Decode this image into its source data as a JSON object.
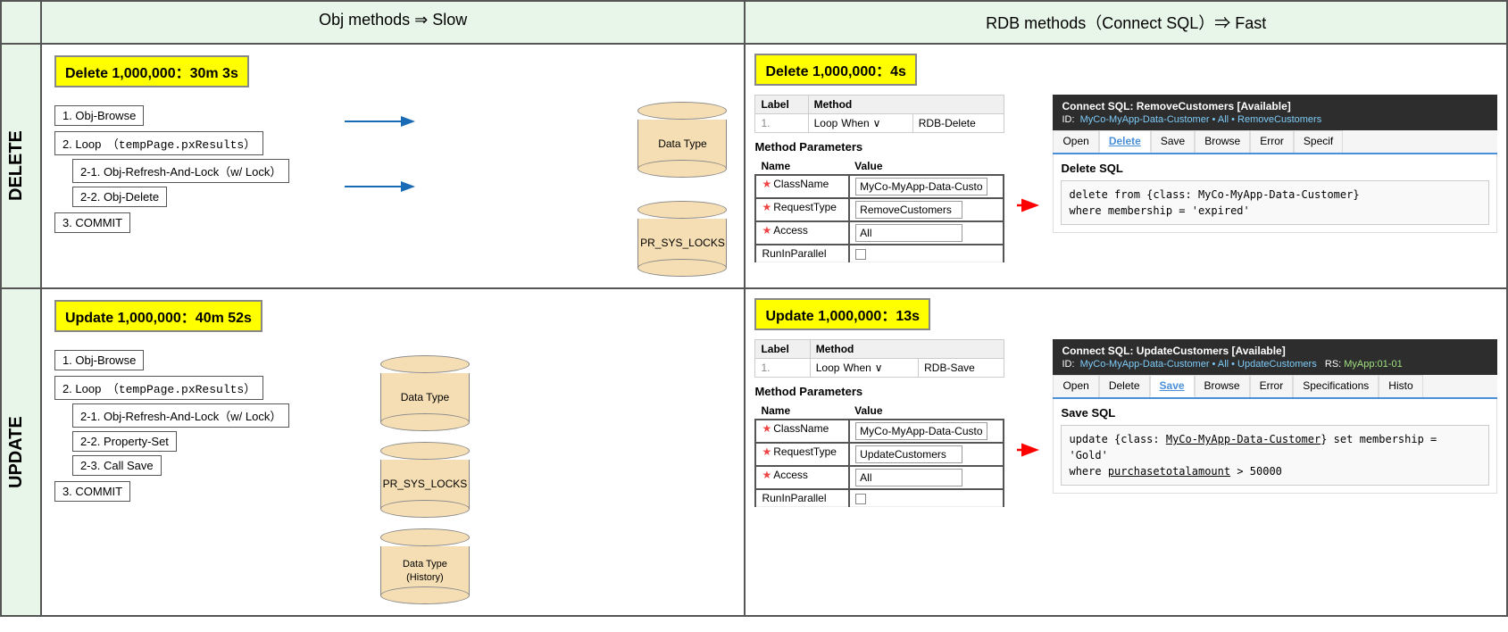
{
  "header": {
    "col1": "Obj methods ⇒ Slow",
    "col2": "RDB methods（Connect SQL）⇒ Fast"
  },
  "delete_row": {
    "label": "DELETE",
    "left": {
      "badge": "Delete 1,000,000：30m 3s",
      "steps": [
        "1. Obj-Browse",
        "2. Loop　（tempPage.pxResults）",
        "2-1. Obj-Refresh-And-Lock（w/ Lock）",
        "2-2. Obj-Delete",
        "3. COMMIT"
      ],
      "db1_label": "Data Type",
      "db2_label": "PR_SYS_LOCKS"
    },
    "right": {
      "badge": "Delete 1,000,000：4s",
      "table": {
        "headers": [
          "Label",
          "Method"
        ],
        "row_num": "1.",
        "loop_label": "Loop",
        "when_label": "When",
        "method_value": "RDB-Delete"
      },
      "method_params_title": "Method Parameters",
      "params": {
        "headers": [
          "Name",
          "Value"
        ],
        "rows": [
          {
            "name": "ClassName",
            "value": "MyCo-MyApp-Data-Custo",
            "required": true
          },
          {
            "name": "RequestType",
            "value": "RemoveCustomers",
            "required": true
          },
          {
            "name": "Access",
            "value": "All",
            "required": true
          },
          {
            "name": "RunInParallel",
            "value": "",
            "required": false,
            "checkbox": true
          }
        ]
      },
      "connect_sql": {
        "header": "Connect SQL: RemoveCustomers [Available]",
        "id": "ID:  MyCo-MyApp-Data-Customer • All • RemoveCustomers",
        "tabs": [
          "Open",
          "Delete",
          "Save",
          "Browse",
          "Error",
          "Specif"
        ],
        "active_tab": "Delete",
        "sql_title": "Delete SQL",
        "sql_code": "delete from {class: MyCo-MyApp-Data-Customer}\nwhere membership = 'expired'"
      }
    }
  },
  "update_row": {
    "label": "UPDATE",
    "left": {
      "badge": "Update 1,000,000：40m 52s",
      "steps": [
        "1. Obj-Browse",
        "2. Loop　（tempPage.pxResults）",
        "2-1. Obj-Refresh-And-Lock（w/ Lock）",
        "2-2. Property-Set",
        "2-3. Call Save",
        "3. COMMIT"
      ],
      "db1_label": "Data Type",
      "db2_label": "PR_SYS_LOCKS",
      "db3_label": "Data Type\n(History)"
    },
    "right": {
      "badge": "Update 1,000,000：13s",
      "table": {
        "headers": [
          "Label",
          "Method"
        ],
        "row_num": "1.",
        "loop_label": "Loop",
        "when_label": "When",
        "method_value": "RDB-Save"
      },
      "method_params_title": "Method Parameters",
      "params": {
        "headers": [
          "Name",
          "Value"
        ],
        "rows": [
          {
            "name": "ClassName",
            "value": "MyCo-MyApp-Data-Custo",
            "required": true
          },
          {
            "name": "RequestType",
            "value": "UpdateCustomers",
            "required": true
          },
          {
            "name": "Access",
            "value": "All",
            "required": true
          },
          {
            "name": "RunInParallel",
            "value": "",
            "required": false,
            "checkbox": true
          }
        ]
      },
      "connect_sql": {
        "header": "Connect SQL: UpdateCustomers [Available]",
        "id": "ID:  MyCo-MyApp-Data-Customer • All • UpdateCustomers    RS:  MyApp:01-01",
        "tabs": [
          "Open",
          "Delete",
          "Save",
          "Browse",
          "Error",
          "Specifications",
          "Histo"
        ],
        "active_tab": "Save",
        "sql_title": "Save SQL",
        "sql_code": "update {class: MyCo-MyApp-Data-Customer} set membership = 'Gold'\nwhere purchasetotalamount > 50000"
      }
    }
  }
}
